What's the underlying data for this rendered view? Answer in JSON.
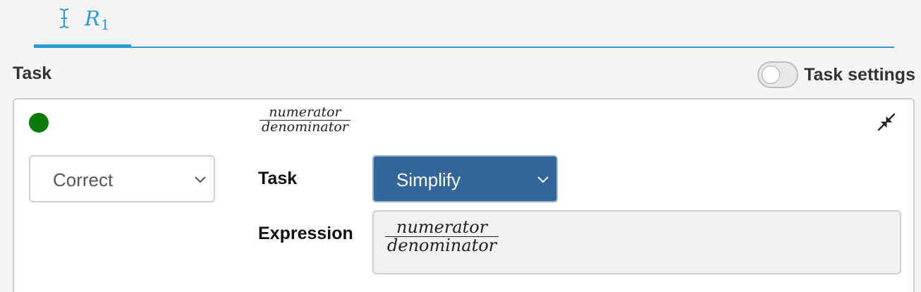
{
  "tabs": [
    {
      "label": "R",
      "subscript": "1",
      "icon": "text-cursor-icon",
      "active": true
    }
  ],
  "section": {
    "title": "Task",
    "settings_toggle": {
      "label": "Task settings",
      "on": false
    }
  },
  "card": {
    "status": {
      "color": "#0a7a0a",
      "state": "correct"
    },
    "header_expression": {
      "numerator": "numerator",
      "denominator": "denominator"
    },
    "collapse_icon": "collapse-arrows-icon",
    "result_select": {
      "value": "Correct"
    },
    "task_row": {
      "label": "Task",
      "value": "Simplify"
    },
    "expression_row": {
      "label": "Expression",
      "numerator": "numerator",
      "denominator": "denominator"
    }
  },
  "colors": {
    "accent": "#2a9ad8",
    "task_select_bg": "#336699",
    "status_green": "#0a7a0a"
  }
}
